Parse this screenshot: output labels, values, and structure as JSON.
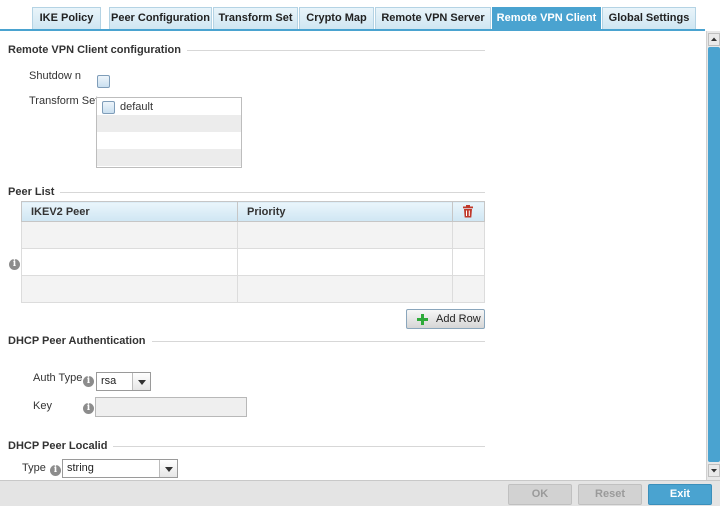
{
  "tabs": [
    {
      "label": "IKE Policy"
    },
    {
      "label": "Peer Configuration"
    },
    {
      "label": "Transform Set"
    },
    {
      "label": "Crypto Map"
    },
    {
      "label": "Remote VPN Server"
    },
    {
      "label": "Remote VPN Client",
      "active": true
    },
    {
      "label": "Global Settings"
    }
  ],
  "client_config": {
    "title": "Remote VPN Client configuration",
    "shutdown_label": "Shutdow n",
    "transform_set_label": "Transform Set",
    "transform_set_items": [
      "default"
    ]
  },
  "peer_list": {
    "title": "Peer List",
    "columns": [
      "IKEV2 Peer",
      "Priority"
    ],
    "rows": [],
    "add_row_label": "Add Row"
  },
  "dhcp_auth": {
    "title": "DHCP Peer Authentication",
    "auth_type_label": "Auth Type",
    "auth_type_value": "rsa",
    "key_label": "Key",
    "key_value": ""
  },
  "dhcp_localid": {
    "title": "DHCP Peer Localid",
    "type_label": "Type",
    "type_value": "string"
  },
  "footer": {
    "ok_label": "OK",
    "reset_label": "Reset",
    "exit_label": "Exit"
  },
  "colors": {
    "accent": "#4aa3d0",
    "delete_icon": "#c0392b",
    "add_icon": "#2eaa3a"
  },
  "icons": [
    "info-icon",
    "trash-icon",
    "plus-icon",
    "chevron-down-icon",
    "scroll-up-icon",
    "scroll-down-icon"
  ]
}
